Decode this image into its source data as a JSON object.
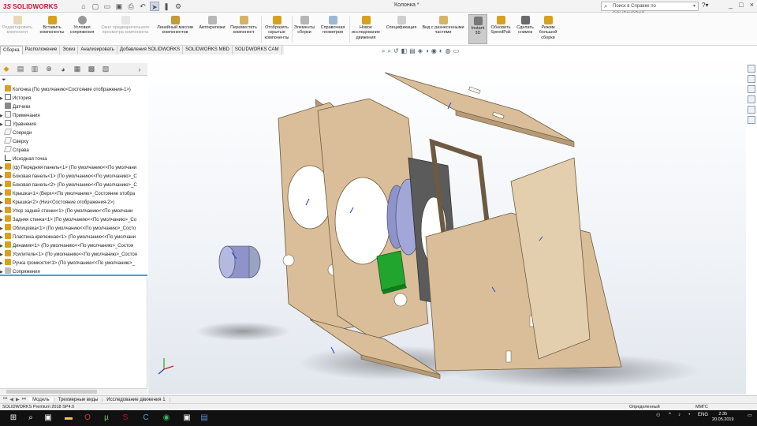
{
  "app": {
    "logo_prefix": "3S",
    "logo_text": "SOLIDWORKS",
    "document_title": "Колонка *",
    "search_placeholder": "Поиск в Справке по SOLIDWORKS",
    "window_controls": [
      "_",
      "□",
      "×"
    ]
  },
  "quick_access": [
    "home-icon",
    "new-icon",
    "open-icon",
    "save-icon",
    "print-icon",
    "undo-icon",
    "select-icon",
    "rebuild-icon",
    "options-icon"
  ],
  "ribbon": [
    {
      "label": "Редактировать компонент",
      "disabled": true
    },
    {
      "label": "Вставить компоненты",
      "disabled": false
    },
    {
      "label": "Условия сопряжения",
      "disabled": false
    },
    {
      "label": "Окно предварительного просмотра компонента",
      "disabled": true
    },
    {
      "label": "Линейный массив компонентов",
      "disabled": false
    },
    {
      "label": "Автокрепежи",
      "disabled": false
    },
    {
      "label": "Переместить компонент",
      "disabled": false
    },
    {
      "label": "Отобразить скрытые компоненты",
      "disabled": false
    },
    {
      "label": "Элементы сборки",
      "disabled": false
    },
    {
      "label": "Справочная геометрия",
      "disabled": false
    },
    {
      "label": "Новое исследование движения",
      "disabled": false
    },
    {
      "label": "Спецификация",
      "disabled": false
    },
    {
      "label": "Вид с разнесенными частями",
      "disabled": false
    },
    {
      "label": "Instant 3D",
      "disabled": false,
      "active": true
    },
    {
      "label": "Обновить SpeedPak",
      "disabled": false
    },
    {
      "label": "Сделать снимок",
      "disabled": false
    },
    {
      "label": "Режим большой сборки",
      "disabled": false
    }
  ],
  "command_tabs": [
    "Сборка",
    "Расположение",
    "Эскиз",
    "Анализировать",
    "Добавления SOLIDWORKS",
    "SOLIDWORKS MBD",
    "SOLIDWORKS CAM"
  ],
  "tree": {
    "root": "Колонка  (По умолчанию<Состояние отображения-1>)",
    "items": [
      {
        "label": "История",
        "icon": "history",
        "expand": true
      },
      {
        "label": "Датчики",
        "icon": "sensor",
        "expand": false
      },
      {
        "label": "Примечания",
        "icon": "note",
        "expand": true
      },
      {
        "label": "Уравнения",
        "icon": "equation",
        "expand": true
      },
      {
        "label": "Спереди",
        "icon": "plane",
        "expand": false
      },
      {
        "label": "Сверху",
        "icon": "plane",
        "expand": false
      },
      {
        "label": "Справа",
        "icon": "plane",
        "expand": false
      },
      {
        "label": "Исходная точка",
        "icon": "origin",
        "expand": false
      },
      {
        "label": "(ф) Передняя панель<1> (По умолчанию<<По умолчани",
        "icon": "part",
        "expand": true
      },
      {
        "label": "Боковая панель<1> (По умолчанию<<По умолчанию>_С",
        "icon": "part",
        "expand": true
      },
      {
        "label": "Боковая панель<2> (По умолчанию<<По умолчанию>_С",
        "icon": "part",
        "expand": true
      },
      {
        "label": "Крышка<1> (Верх<<По умолчанию>_Состояние отобра",
        "icon": "part",
        "expand": true
      },
      {
        "label": "Крышка<2> (Низ<Состояние отображения-2>)",
        "icon": "part",
        "expand": true
      },
      {
        "label": "Упор задней стенки<1> (По умолчанию<<По умолчани",
        "icon": "part",
        "expand": true
      },
      {
        "label": "Задняя стенка<1> (По умолчанию<<По умолчанию>_Со",
        "icon": "part",
        "expand": true
      },
      {
        "label": "Облицовка<1> (По умолчанию<<По умолчанию>_Состо",
        "icon": "part",
        "expand": true
      },
      {
        "label": "Пластина крепежная<1> (По умолчанию<<По умолчани",
        "icon": "part",
        "expand": true
      },
      {
        "label": "Динамик<1> (По умолчанию<<По умолчанию>_Состоя",
        "icon": "part",
        "expand": true
      },
      {
        "label": "Усилитель<1> (По умолчанию<<По умолчанию>_Состоя",
        "icon": "part",
        "expand": true
      },
      {
        "label": "Ручка громкости<1> (По умолчанию<<По умолчанию>_",
        "icon": "part",
        "expand": true
      },
      {
        "label": "Сопряжения",
        "icon": "mate",
        "expand": true
      }
    ]
  },
  "bottom_tabs": [
    "Модель",
    "Трехмерные виды",
    "Исследование движения 1"
  ],
  "status": {
    "left": "SOLIDWORKS Premium 2018 SP4.0",
    "middle": "Определенный",
    "right": "ММГС"
  },
  "taskbar": {
    "lang": "ENG",
    "time": "2:35",
    "date": "20.05.2019"
  },
  "colors": {
    "wood": "#d9be99",
    "wood_dark": "#b69a76",
    "accent": "#4c9ed9",
    "speaker": "#8f93c9",
    "board": "#22a52e"
  }
}
